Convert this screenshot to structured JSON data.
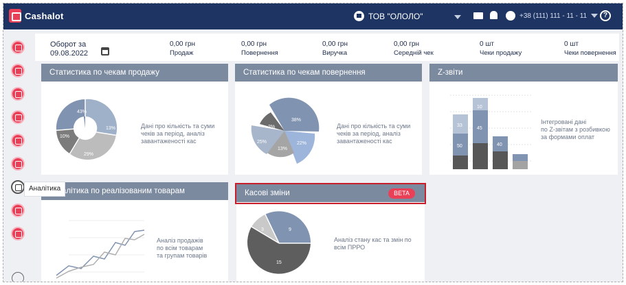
{
  "topbar": {
    "logo": "Cashalot",
    "company": "ТОВ \"ОЛОЛО\"",
    "phone": "+38 (111) 111 - 11 - 11",
    "help": "?"
  },
  "sidebar": {
    "tooltip": "Аналітика"
  },
  "summary": {
    "period_label": "Оборот за",
    "period_date": "09.08.2022",
    "metrics": [
      {
        "value": "0,00 грн",
        "label": "Продаж"
      },
      {
        "value": "0,00 грн",
        "label": "Повернення"
      },
      {
        "value": "0,00 грн",
        "label": "Виручка"
      },
      {
        "value": "0,00 грн",
        "label": "Середній чек"
      },
      {
        "value": "0 шт",
        "label": "Чеки продажу"
      },
      {
        "value": "0 шт",
        "label": "Чеки повернення"
      }
    ]
  },
  "cards": {
    "sales": {
      "title": "Статистика по чекам продажу",
      "desc": [
        "Дані про кількість та суми",
        "чеків за період, аналіз",
        "завантаженості кас"
      ],
      "slice_labels": [
        "43%",
        "13%",
        "29%",
        "10%"
      ]
    },
    "returns": {
      "title": "Статистика по чекам повернення",
      "desc": [
        "Дані про кількість та суми",
        "чеків за період, аналіз",
        "завантаженості кас"
      ],
      "slice_labels": [
        "38%",
        "22%",
        "13%",
        "25%",
        "2%"
      ]
    },
    "zreports": {
      "title": "Z-звіти",
      "desc": [
        "Інтегровані дані",
        "по Z-звітам з розбивкою",
        "за формами оплат"
      ],
      "bar_labels": [
        "33",
        "50",
        "10",
        "45",
        "40"
      ]
    },
    "goods": {
      "title": "Аналітика по реалізованим товарам",
      "desc": [
        "Аналіз продажів",
        "по всім товарам",
        "та групам товарів"
      ]
    },
    "shifts": {
      "title": "Касові зміни",
      "badge": "BETA",
      "desc": [
        "Аналіз стану кас та змін по",
        "всім ПРРО"
      ],
      "slice_labels": [
        "9",
        "15",
        "3"
      ]
    }
  },
  "colors": {
    "navbar": "#1e3563",
    "accent": "#e94058",
    "card_header": "#7c8aa0",
    "highlight": "#c81e2b"
  }
}
